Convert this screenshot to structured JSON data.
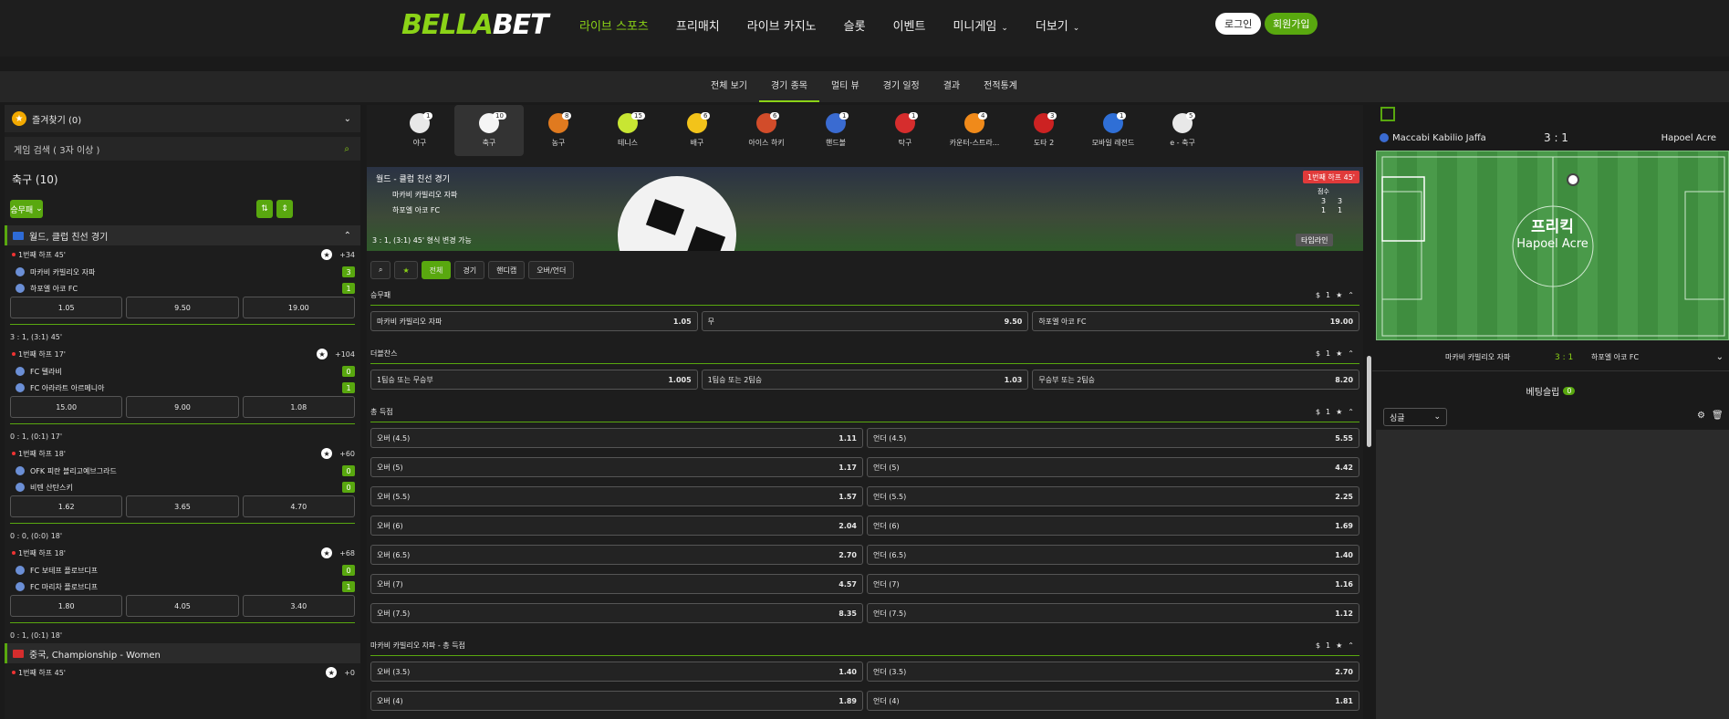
{
  "brand": {
    "logo_a": "BELLA",
    "logo_b": "BET"
  },
  "nav": [
    {
      "label": "라이브 스포츠",
      "active": true
    },
    {
      "label": "프리매치"
    },
    {
      "label": "라이브 카지노"
    },
    {
      "label": "슬롯"
    },
    {
      "label": "이벤트"
    },
    {
      "label": "미니게임",
      "caret": true
    },
    {
      "label": "더보기",
      "caret": true
    }
  ],
  "auth": {
    "login": "로그인",
    "join": "회원가입"
  },
  "subnav": [
    "전체 보기",
    "경기 종목",
    "멀티 뷰",
    "경기 일정",
    "결과",
    "전적통계"
  ],
  "left": {
    "favorites": "즐겨찾기 (0)",
    "search_placeholder": "게임 검색 ( 3자 이상 )",
    "sport_title": "축구 (10)",
    "filter_label": "승무패",
    "league1": "월드, 클럽 친선 경기",
    "matches": [
      {
        "time": "1번째 하프 45'",
        "more": "+34",
        "home": "마카비 카빌리오 자파",
        "away": "하포엘 아코 FC",
        "hs": "3",
        "as": "1",
        "odds": [
          "1.05",
          "9.50",
          "19.00"
        ],
        "ft": "3 : 1, (3:1) 45'"
      },
      {
        "time": "1번째 하프 17'",
        "more": "+104",
        "home": "FC 텔라비",
        "away": "FC 아라라트 아르메니아",
        "hs": "0",
        "as": "1",
        "odds": [
          "15.00",
          "9.00",
          "1.08"
        ],
        "ft": "0 : 1, (0:1) 17'"
      },
      {
        "time": "1번째 하프 18'",
        "more": "+60",
        "home": "OFK 피란 블리고예브그라드",
        "away": "비텐 산탄스키",
        "hs": "0",
        "as": "0",
        "odds": [
          "1.62",
          "3.65",
          "4.70"
        ],
        "ft": "0 : 0, (0:0) 18'"
      },
      {
        "time": "1번째 하프 18'",
        "more": "+68",
        "home": "FC 보테프 플로브디프",
        "away": "FC 마리차 플로브디프",
        "hs": "0",
        "as": "1",
        "odds": [
          "1.80",
          "4.05",
          "3.40"
        ],
        "ft": "0 : 1, (0:1) 18'"
      }
    ],
    "league2": "중국, Championship - Women",
    "last_time": "1번째 하프 45'",
    "last_more": "+0"
  },
  "sports": [
    {
      "label": "야구",
      "count": "1",
      "color": "#e8e8e8"
    },
    {
      "label": "축구",
      "count": "10",
      "color": "#f5f5f5",
      "active": true
    },
    {
      "label": "농구",
      "count": "8",
      "color": "#e07a1f"
    },
    {
      "label": "테니스",
      "count": "15",
      "color": "#c8e633"
    },
    {
      "label": "배구",
      "count": "6",
      "color": "#f2c31a"
    },
    {
      "label": "아이스 하키",
      "count": "6",
      "color": "#d24c2a"
    },
    {
      "label": "핸드볼",
      "count": "1",
      "color": "#3a6bd1"
    },
    {
      "label": "탁구",
      "count": "1",
      "color": "#d62d2d"
    },
    {
      "label": "카운터-스트라...",
      "count": "4",
      "color": "#f08a1a"
    },
    {
      "label": "도타 2",
      "count": "3",
      "color": "#cc2222"
    },
    {
      "label": "모바일 레전드",
      "count": "1",
      "color": "#2f6fd6"
    },
    {
      "label": "e - 축구",
      "count": "5",
      "color": "#e8e8e8"
    }
  ],
  "banner": {
    "league": "월드 - 클럽 친선 경기",
    "live": "1번째 하프 45'",
    "home": "마카비 카빌리오 자파",
    "away": "하포엘 아코 FC",
    "col_label": "점수",
    "h1": "3",
    "h2": "3",
    "a1": "1",
    "a2": "1",
    "status": "3 : 1, (3:1) 45'   형식 변경 가능",
    "timeline": "타임라인"
  },
  "tools": {
    "all": "전체",
    "match": "경기",
    "handicap": "핸디캡",
    "ou": "오버/언더"
  },
  "markets": [
    {
      "title": "승무패",
      "count": "1",
      "rows": [
        [
          {
            "n": "마카비 카빌리오 자파",
            "v": "1.05"
          },
          {
            "n": "무",
            "v": "9.50"
          },
          {
            "n": "하포엘 아코 FC",
            "v": "19.00"
          }
        ]
      ]
    },
    {
      "title": "더블찬스",
      "count": "1",
      "rows": [
        [
          {
            "n": "1팀승 또는 무승부",
            "v": "1.005"
          },
          {
            "n": "1팀승 또는 2팀승",
            "v": "1.03"
          },
          {
            "n": "무승부 또는 2팀승",
            "v": "8.20"
          }
        ]
      ]
    },
    {
      "title": "총 득점",
      "count": "1",
      "rows": [
        [
          {
            "n": "오버 (4.5)",
            "v": "1.11"
          },
          {
            "n": "언더 (4.5)",
            "v": "5.55"
          }
        ],
        [
          {
            "n": "오버 (5)",
            "v": "1.17"
          },
          {
            "n": "언더 (5)",
            "v": "4.42"
          }
        ],
        [
          {
            "n": "오버 (5.5)",
            "v": "1.57"
          },
          {
            "n": "언더 (5.5)",
            "v": "2.25"
          }
        ],
        [
          {
            "n": "오버 (6)",
            "v": "2.04"
          },
          {
            "n": "언더 (6)",
            "v": "1.69"
          }
        ],
        [
          {
            "n": "오버 (6.5)",
            "v": "2.70"
          },
          {
            "n": "언더 (6.5)",
            "v": "1.40"
          }
        ],
        [
          {
            "n": "오버 (7)",
            "v": "4.57"
          },
          {
            "n": "언더 (7)",
            "v": "1.16"
          }
        ],
        [
          {
            "n": "오버 (7.5)",
            "v": "8.35"
          },
          {
            "n": "언더 (7.5)",
            "v": "1.12"
          }
        ]
      ]
    },
    {
      "title": "마카비 카빌리오 자파 - 총 득점",
      "count": "1",
      "rows": [
        [
          {
            "n": "오버 (3.5)",
            "v": "1.40"
          },
          {
            "n": "언더 (3.5)",
            "v": "2.70"
          }
        ],
        [
          {
            "n": "오버 (4)",
            "v": "1.89"
          },
          {
            "n": "언더 (4)",
            "v": "1.81"
          }
        ]
      ]
    }
  ],
  "right": {
    "home": "Maccabi Kabilio Jaffa",
    "away": "Hapoel Acre",
    "score": "3 : 1",
    "field_title": "프리킥",
    "field_team": "Hapoel Acre",
    "bottom_home": "마카비 카빌리오 자파",
    "bottom_score": "3 : 1",
    "bottom_away": "하포엘 아코 FC",
    "slip_label": "베팅슬립",
    "slip_count": "0",
    "mode": "싱글"
  }
}
